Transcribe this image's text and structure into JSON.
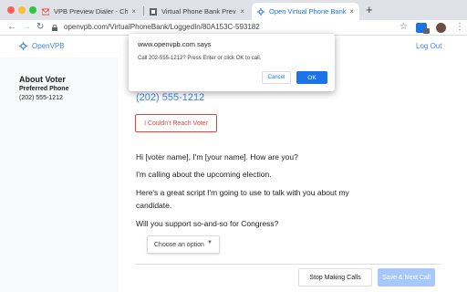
{
  "browser": {
    "tabs": [
      {
        "title": "VPB Preview Dialer - Chrome We",
        "active": false
      },
      {
        "title": "Virtual Phone Bank Preview Diale",
        "active": false
      },
      {
        "title": "Open Virtual Phone Bank",
        "active": true
      }
    ],
    "new_tab_symbol": "+",
    "close_symbol": "×",
    "url": "openvpb.com/VirtualPhoneBank/LoggedIn/80A153C-593182",
    "colors": {
      "tabstrip": "#dee1e6",
      "accent": "#1a73e8"
    }
  },
  "header": {
    "brand": "OpenVPB",
    "logout": "Log Out",
    "brand_color": "#4285f4"
  },
  "sidebar": {
    "heading": "About Voter",
    "phone_label": "Preferred Phone",
    "phone_value": "(202) 555-1212"
  },
  "main": {
    "phone": "(202) 555-1212",
    "reach_button": "I Couldn't Reach Voter",
    "script": [
      "Hi [voter name], I'm [your name]. How are you?",
      "I'm calling about the upcoming election.",
      "Here's a great script I'm going to use to talk with you about my candidate.",
      "Will you support so-and-so for Congress?"
    ],
    "select_placeholder": "Choose an option",
    "stop_button": "Stop Making Calls",
    "save_button": "Save & Next Call"
  },
  "dialog": {
    "title": "www.openvpb.com says",
    "message": "Call 202-555-1212? Press Enter or click OK to call.",
    "cancel": "Cancel",
    "ok": "OK"
  }
}
